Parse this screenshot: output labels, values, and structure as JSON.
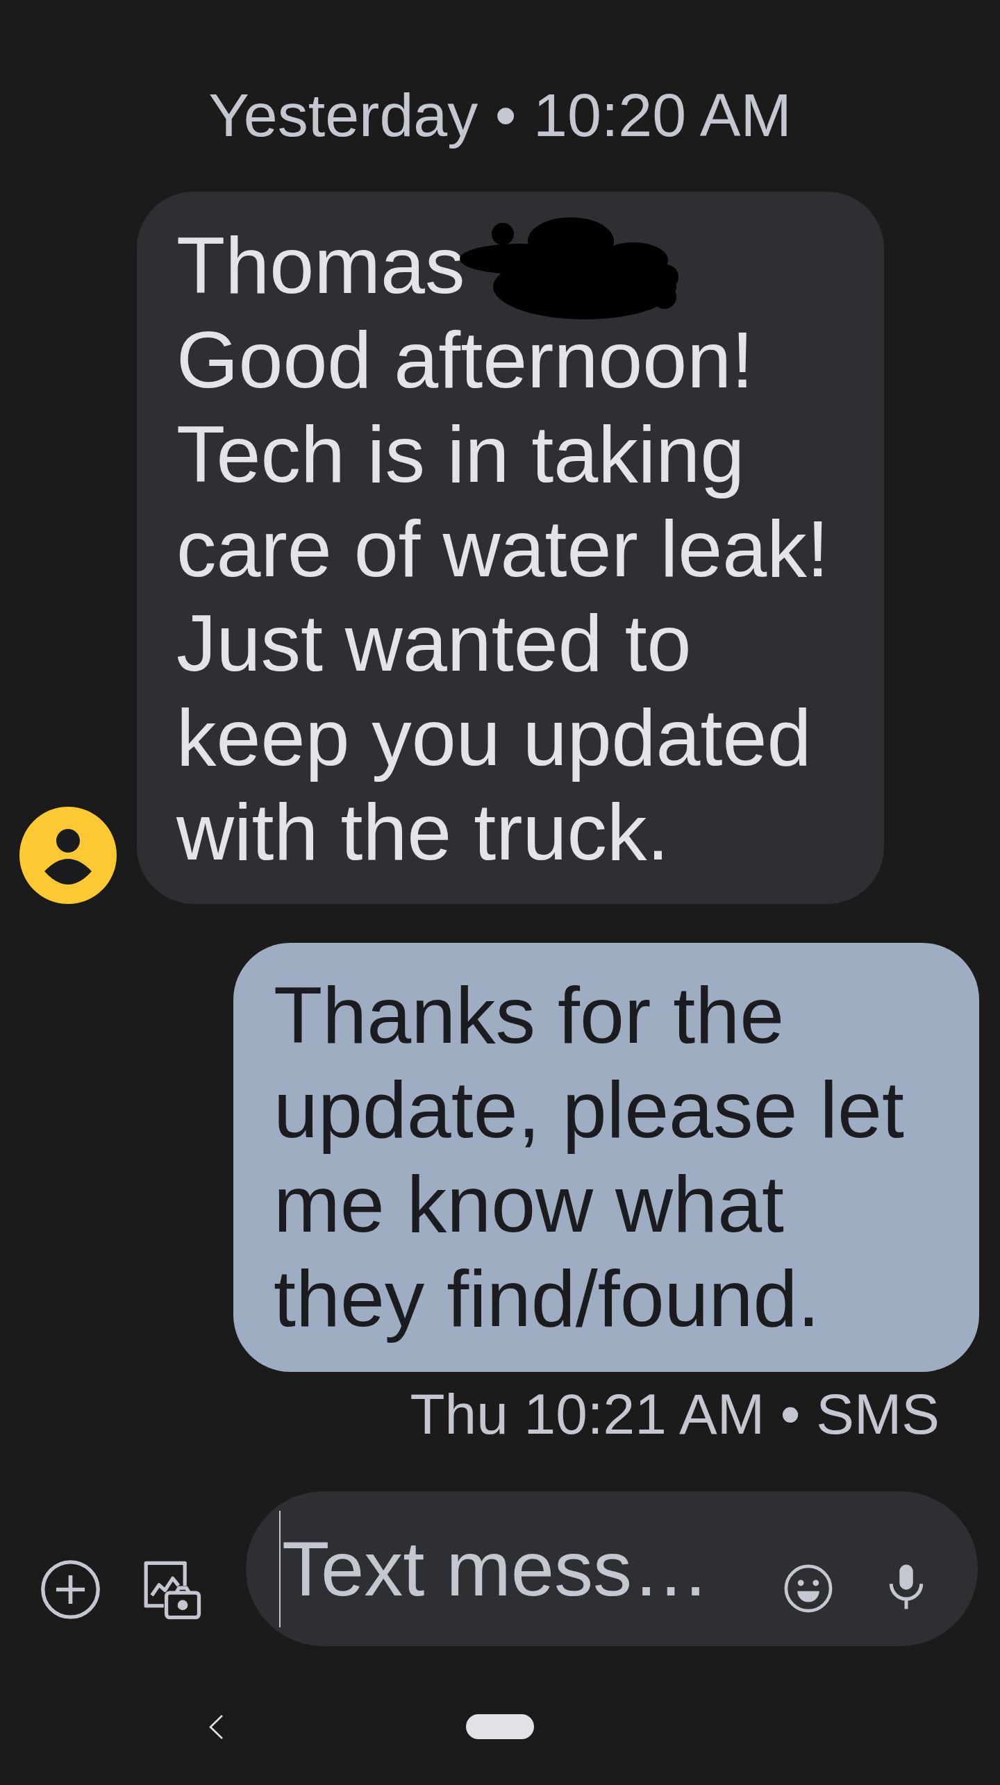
{
  "header": {
    "timestamp": "Yesterday • 10:20 AM"
  },
  "messages": [
    {
      "kind": "incoming",
      "text": "Thomas\nGood afternoon! Tech is in taking care of water leak! Just wanted to keep you updated with the truck.",
      "redacted": true
    },
    {
      "kind": "outgoing",
      "text": "Thanks for the update, please let me know what they find/found.",
      "status": "Thu 10:21 AM • SMS"
    }
  ],
  "compose": {
    "placeholder": "Text mess…",
    "focused": true
  }
}
